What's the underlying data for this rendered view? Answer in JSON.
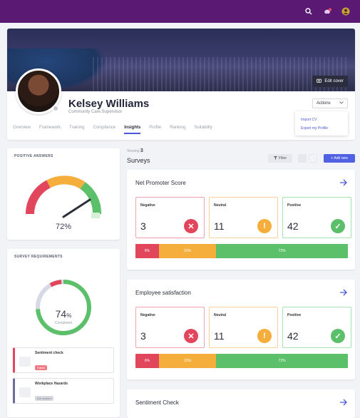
{
  "header": {
    "icons": [
      "search-icon",
      "notifications-icon",
      "user-icon"
    ]
  },
  "profile": {
    "name": "Kelsey Williams",
    "role": "Community Care Supervisor",
    "edit_cover_label": "Edit cover",
    "actions_label": "Actions",
    "actions_menu": [
      "Import CV",
      "Export my Profile"
    ],
    "tabs": [
      "Overview",
      "Framework",
      "Training",
      "Compliance",
      "Insights",
      "Profile",
      "Ranking",
      "Suitability"
    ],
    "active_tab": "Insights"
  },
  "positive_answers": {
    "title": "POSITIVE ANSWERS",
    "value": "72%",
    "gauge_fraction": 0.72
  },
  "requirements": {
    "title": "SURVEY REQUIREMENTS",
    "donut_value": "74",
    "donut_unit": "%",
    "donut_label": "Completed",
    "items": [
      {
        "name": "Sentiment check",
        "status": "Failed"
      },
      {
        "name": "Workplace Hazards",
        "status": "Not started"
      }
    ]
  },
  "toolbar": {
    "viewing_label": "Viewing",
    "viewing_count": "3",
    "title": "Surveys",
    "filter_label": "Filter",
    "add_label": "Add new"
  },
  "surveys": [
    {
      "title": "Net Promoter Score",
      "negative_label": "Negative",
      "negative": "3",
      "neutral_label": "Neutral",
      "neutral": "11",
      "positive_label": "Positive",
      "positive": "42",
      "bar": [
        {
          "label": "6%",
          "fraction": 0.11,
          "color": "#e2465d"
        },
        {
          "label": "22%",
          "fraction": 0.27,
          "color": "#f5ad3b"
        },
        {
          "label": "72%",
          "fraction": 0.62,
          "color": "#5cc06a"
        }
      ]
    },
    {
      "title": "Employee satisfaction",
      "negative_label": "Negative",
      "negative": "3",
      "neutral_label": "Neutral",
      "neutral": "11",
      "positive_label": "Positive",
      "positive": "42",
      "bar": [
        {
          "label": "6%",
          "fraction": 0.11,
          "color": "#e2465d"
        },
        {
          "label": "22%",
          "fraction": 0.27,
          "color": "#f5ad3b"
        },
        {
          "label": "72%",
          "fraction": 0.62,
          "color": "#5cc06a"
        }
      ]
    },
    {
      "title": "Sentiment Check"
    }
  ]
}
